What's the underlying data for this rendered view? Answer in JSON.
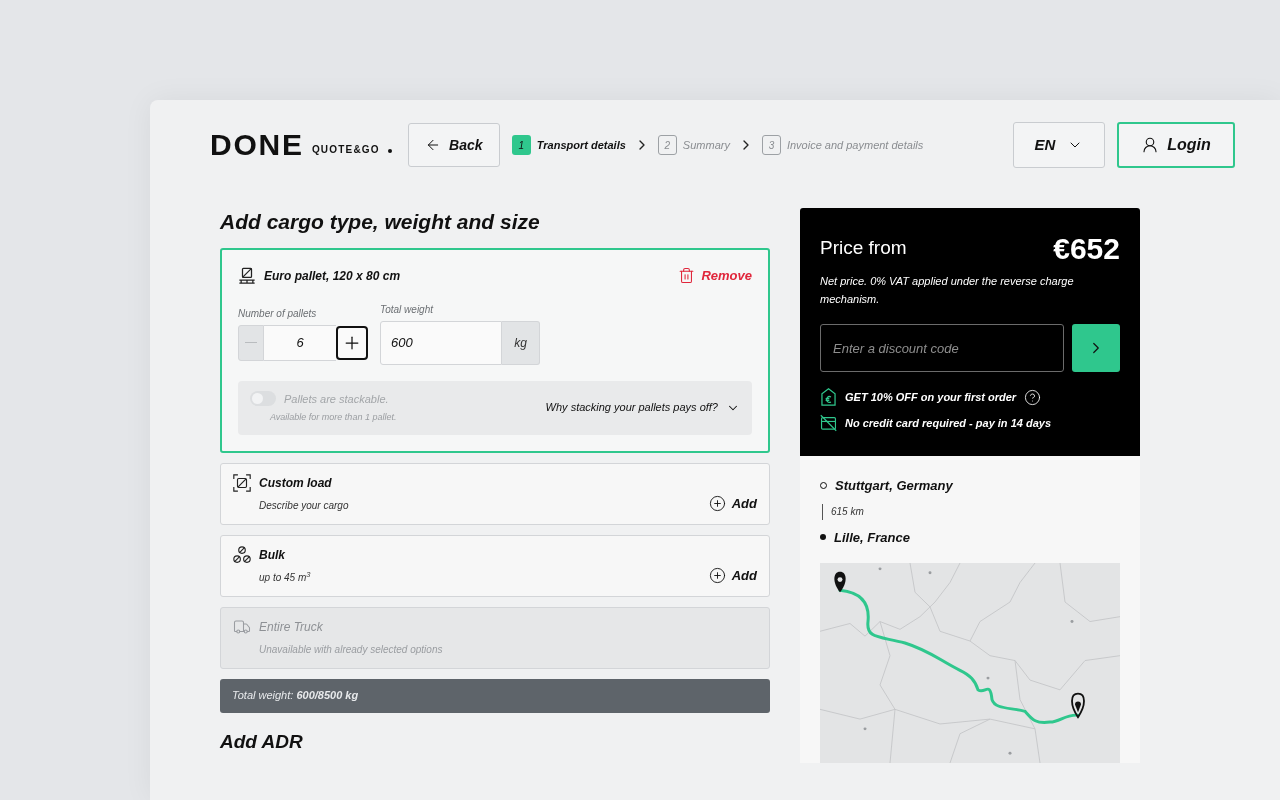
{
  "header": {
    "logo": "DONE",
    "logo_tagline": "QUOTE&GO",
    "back_button": "Back",
    "steps": [
      {
        "number": "1",
        "label": "Transport details",
        "selected": true
      },
      {
        "number": "2",
        "label": "Summary",
        "selected": false
      },
      {
        "number": "3",
        "label": "Invoice and payment details",
        "selected": false
      }
    ],
    "language": "EN",
    "login_button": "Login"
  },
  "cargo": {
    "heading": "Add cargo type, weight and size",
    "selected_item": {
      "title": "Euro pallet, 120 x 80 cm",
      "remove_label": "Remove",
      "count": {
        "label": "Number of pallets",
        "value": "6",
        "decrease_disabled": true
      },
      "weight": {
        "label": "Total weight",
        "value": "600",
        "unit": "kg"
      },
      "stackable": {
        "label": "Pallets are stackable.",
        "hint": "Available for more than 1 pallet.",
        "on": false,
        "disabled": true
      },
      "info_toggle": {
        "label": "Why stacking your pallets pays off?",
        "expanded": false
      }
    },
    "options": [
      {
        "kind": "custom",
        "title": "Custom load",
        "subtitle": "Describe your cargo",
        "action": "Add",
        "disabled": false
      },
      {
        "kind": "bulk",
        "title": "Bulk",
        "subtitle": "up to 45 m$^{3}$",
        "action": "Add",
        "disabled": false
      },
      {
        "kind": "truck",
        "title": "Entire Truck",
        "subtitle": "Unavailable with already selected options",
        "disabled": true
      }
    ],
    "total_weight": "Total weight: **600/8500 kg**"
  },
  "next_section": {
    "heading": "Add ADR"
  },
  "price_card": {
    "label": "Price from",
    "price": "€652",
    "note": "Net price. 0% VAT applied under the reverse charge mechanism.",
    "discount": {
      "placeholder": "Enter a discount code"
    },
    "perks": [
      {
        "kind": "discount",
        "text": "GET 10% OFF on your first order"
      },
      {
        "kind": "payment",
        "text": "No credit card required - pay in 14 days"
      }
    ]
  },
  "route": {
    "origin": "Stuttgart, Germany",
    "distance": "615 km",
    "destination": "Lille, France"
  }
}
